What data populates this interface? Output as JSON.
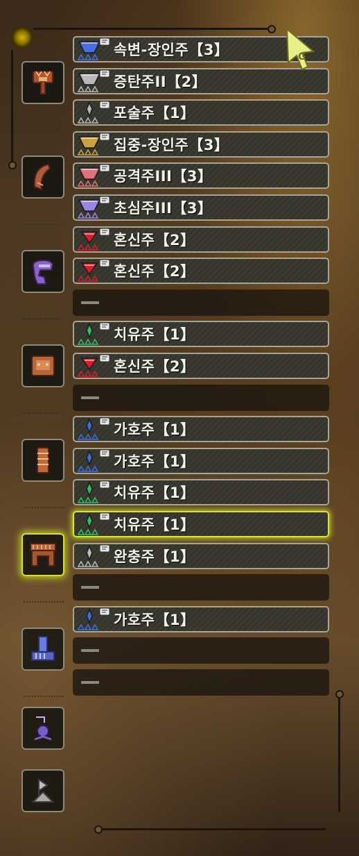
{
  "equipment_categories": [
    {
      "name": "weapon",
      "icon": "weapon-icon",
      "active": false
    },
    {
      "name": "head",
      "icon": "helmet-icon",
      "active": false
    },
    {
      "name": "chest",
      "icon": "chest-armor-icon",
      "active": false
    },
    {
      "name": "arms",
      "icon": "gauntlet-icon",
      "active": false
    },
    {
      "name": "waist",
      "icon": "waist-armor-icon",
      "active": true
    },
    {
      "name": "legs",
      "icon": "greaves-icon",
      "active": false
    },
    {
      "name": "charm",
      "icon": "charm-icon",
      "active": false
    },
    {
      "name": "mantle",
      "icon": "mantle-icon",
      "active": false
    }
  ],
  "slots": [
    {
      "label": "속변-장인주【3】",
      "gem_color": "#4a6fe0",
      "tier": "large",
      "empty": false
    },
    {
      "label": "증탄주II【2】",
      "gem_color": "#b8b8b8",
      "tier": "large",
      "empty": false
    },
    {
      "label": "포술주【1】",
      "gem_color": "#b8b8b8",
      "tier": "small",
      "empty": false
    },
    {
      "label": "집중-장인주【3】",
      "gem_color": "#c9a43e",
      "tier": "large",
      "empty": false
    },
    {
      "label": "공격주III【3】",
      "gem_color": "#e0707a",
      "tier": "large",
      "empty": false
    },
    {
      "label": "초심주III【3】",
      "gem_color": "#9b84e0",
      "tier": "large",
      "empty": false
    },
    {
      "label": "혼신주【2】",
      "gem_color": "#d81e2a",
      "tier": "medium",
      "empty": false
    },
    {
      "label": "혼신주【2】",
      "gem_color": "#d81e2a",
      "tier": "medium",
      "empty": false
    },
    {
      "label": "",
      "gem_color": "",
      "tier": "",
      "empty": true
    },
    {
      "label": "치유주【1】",
      "gem_color": "#2cc060",
      "tier": "small",
      "empty": false
    },
    {
      "label": "혼신주【2】",
      "gem_color": "#d81e2a",
      "tier": "medium",
      "empty": false
    },
    {
      "label": "",
      "gem_color": "",
      "tier": "",
      "empty": true
    },
    {
      "label": "가호주【1】",
      "gem_color": "#3a6ee8",
      "tier": "small",
      "empty": false
    },
    {
      "label": "가호주【1】",
      "gem_color": "#3a6ee8",
      "tier": "small",
      "empty": false
    },
    {
      "label": "치유주【1】",
      "gem_color": "#2cc060",
      "tier": "small",
      "empty": false
    },
    {
      "label": "치유주【1】",
      "gem_color": "#2cc060",
      "tier": "small",
      "empty": false,
      "highlight": true
    },
    {
      "label": "완충주【1】",
      "gem_color": "#b8b8b8",
      "tier": "small",
      "empty": false
    },
    {
      "label": "",
      "gem_color": "",
      "tier": "",
      "empty": true
    },
    {
      "label": "가호주【1】",
      "gem_color": "#3a6ee8",
      "tier": "small",
      "empty": false
    },
    {
      "label": "",
      "gem_color": "",
      "tier": "",
      "empty": true
    },
    {
      "label": "",
      "gem_color": "",
      "tier": "",
      "empty": true
    }
  ],
  "colors": {
    "highlight": "#d8e830",
    "slot_border": "#a8a594",
    "text": "#f2f2ec"
  }
}
